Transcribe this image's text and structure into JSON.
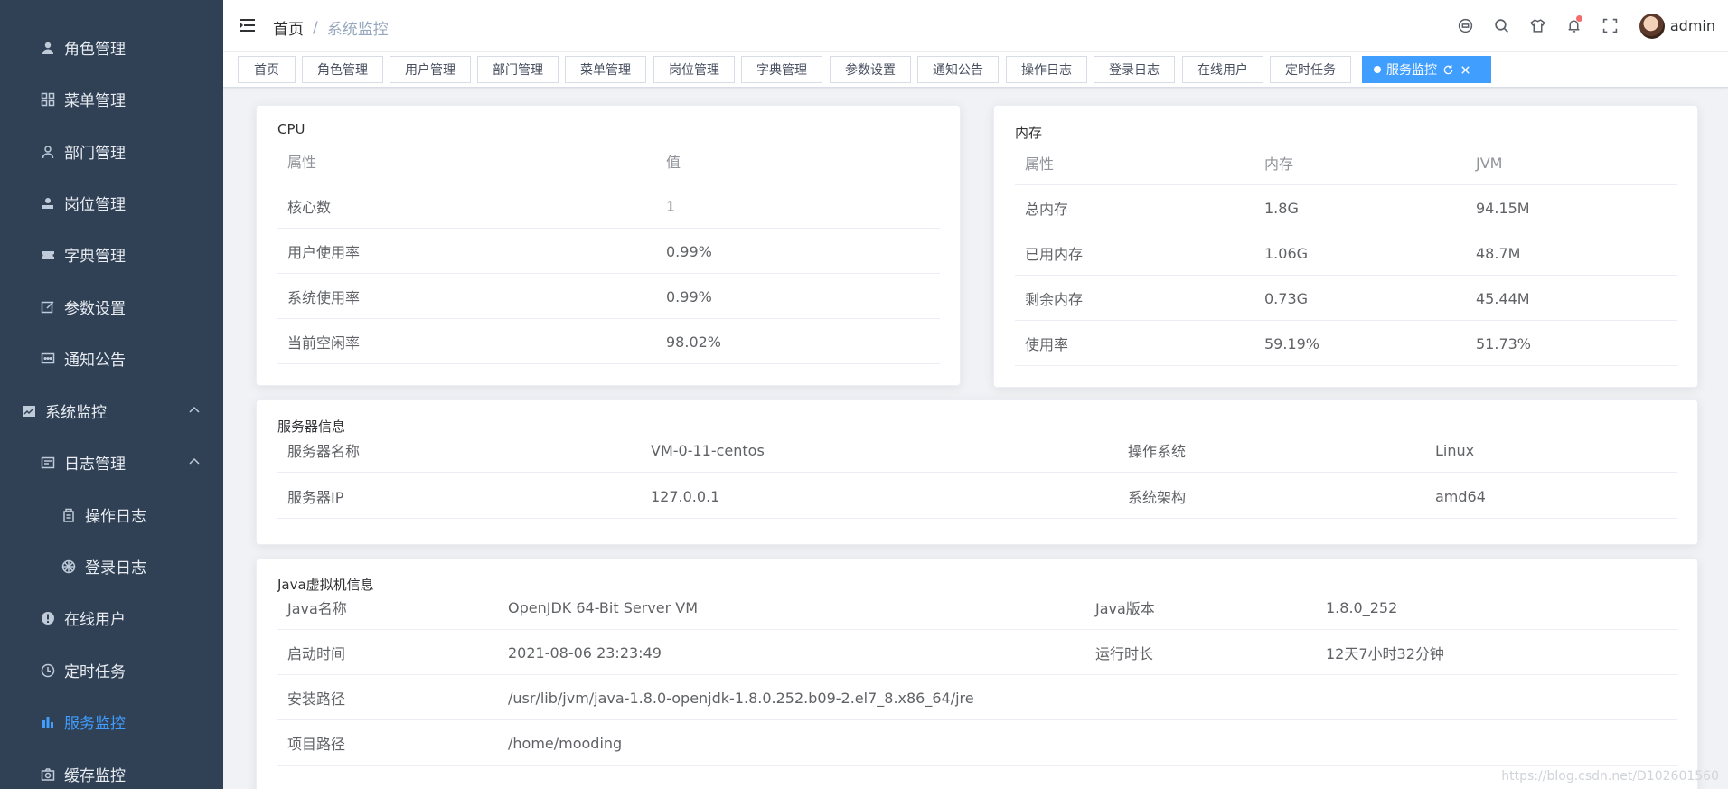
{
  "sidebar": {
    "items": [
      {
        "label": "角色管理",
        "icon": "user-icon"
      },
      {
        "label": "菜单管理",
        "icon": "grid-icon"
      },
      {
        "label": "部门管理",
        "icon": "person-outline-icon"
      },
      {
        "label": "岗位管理",
        "icon": "post-icon"
      },
      {
        "label": "字典管理",
        "icon": "ticket-icon"
      },
      {
        "label": "参数设置",
        "icon": "edit-icon"
      },
      {
        "label": "通知公告",
        "icon": "message-icon"
      },
      {
        "label": "系统监控",
        "icon": "monitor-icon"
      },
      {
        "label": "日志管理",
        "icon": "log-icon"
      },
      {
        "label": "操作日志",
        "icon": "form-icon"
      },
      {
        "label": "登录日志",
        "icon": "login-icon"
      },
      {
        "label": "在线用户",
        "icon": "online-icon"
      },
      {
        "label": "定时任务",
        "icon": "clock-icon"
      },
      {
        "label": "服务监控",
        "icon": "chart-icon"
      },
      {
        "label": "缓存监控",
        "icon": "camera-icon"
      }
    ]
  },
  "navbar": {
    "breadcrumb_home": "首页",
    "breadcrumb_sep": "/",
    "breadcrumb_current": "系统监控",
    "user": "admin"
  },
  "tags": [
    "首页",
    "角色管理",
    "用户管理",
    "部门管理",
    "菜单管理",
    "岗位管理",
    "字典管理",
    "参数设置",
    "通知公告",
    "操作日志",
    "登录日志",
    "在线用户",
    "定时任务",
    "服务监控"
  ],
  "cpu": {
    "title": "CPU",
    "headers": [
      "属性",
      "值"
    ],
    "rows": [
      [
        "核心数",
        "1"
      ],
      [
        "用户使用率",
        "0.99%"
      ],
      [
        "系统使用率",
        "0.99%"
      ],
      [
        "当前空闲率",
        "98.02%"
      ]
    ]
  },
  "memory": {
    "title": "内存",
    "headers": [
      "属性",
      "内存",
      "JVM"
    ],
    "rows": [
      [
        "总内存",
        "1.8G",
        "94.15M"
      ],
      [
        "已用内存",
        "1.06G",
        "48.7M"
      ],
      [
        "剩余内存",
        "0.73G",
        "45.44M"
      ],
      [
        "使用率",
        "59.19%",
        "51.73%"
      ]
    ]
  },
  "server": {
    "title": "服务器信息",
    "rows": [
      [
        "服务器名称",
        "VM-0-11-centos",
        "操作系统",
        "Linux"
      ],
      [
        "服务器IP",
        "127.0.0.1",
        "系统架构",
        "amd64"
      ]
    ]
  },
  "jvm": {
    "title": "Java虚拟机信息",
    "rows": [
      [
        "Java名称",
        "OpenJDK 64-Bit Server VM",
        "Java版本",
        "1.8.0_252"
      ],
      [
        "启动时间",
        "2021-08-06 23:23:49",
        "运行时长",
        "12天7小时32分钟"
      ],
      [
        "安装路径",
        "/usr/lib/jvm/java-1.8.0-openjdk-1.8.0.252.b09-2.el7_8.x86_64/jre",
        "",
        ""
      ],
      [
        "项目路径",
        "/home/mooding",
        "",
        ""
      ]
    ]
  },
  "watermark": "https://blog.csdn.net/D102601560",
  "colors": {
    "accent": "#409eff",
    "sidebar": "#304156"
  }
}
